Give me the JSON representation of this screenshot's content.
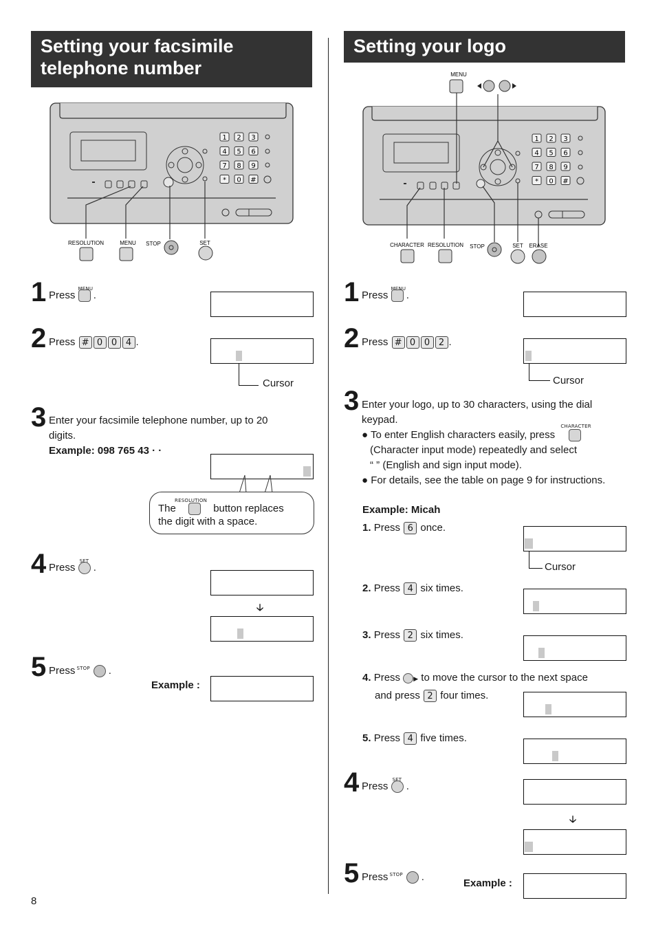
{
  "page_number": "8",
  "left": {
    "title_line1": "Setting your facsimile",
    "title_line2": "telephone number",
    "diagram_labels": {
      "resolution": "RESOLUTION",
      "menu": "MENU",
      "stop": "STOP",
      "set": "SET"
    },
    "keypad": [
      "1",
      "2",
      "3",
      "4",
      "5",
      "6",
      "7",
      "8",
      "9",
      "*",
      "0",
      "#"
    ],
    "steps": [
      {
        "num": "1",
        "text": "Press",
        "button": "MENU",
        "suffix": "."
      },
      {
        "num": "2",
        "text": "Press",
        "keys": [
          "#",
          "0",
          "0",
          "4"
        ],
        "suffix": ".",
        "cursor_label": "Cursor"
      },
      {
        "num": "3",
        "text_line1": "Enter your facsimile telephone number, up to 20",
        "text_line2": "digits.",
        "example": "Example: 098 765 43 · ·",
        "bubble_pre": "The",
        "bubble_button": "RESOLUTION",
        "bubble_post": "button replaces",
        "bubble_line2": "the digit with a space."
      },
      {
        "num": "4",
        "text": "Press",
        "button": "SET",
        "suffix": "."
      },
      {
        "num": "5",
        "text": "Press",
        "button": "STOP",
        "suffix": ".",
        "example_label": "Example :"
      }
    ]
  },
  "right": {
    "title": "Setting your logo",
    "diagram_labels": {
      "menu": "MENU",
      "character": "CHARACTER",
      "resolution": "RESOLUTION",
      "stop": "STOP",
      "set": "SET",
      "erase": "ERASE"
    },
    "keypad": [
      "1",
      "2",
      "3",
      "4",
      "5",
      "6",
      "7",
      "8",
      "9",
      "*",
      "0",
      "#"
    ],
    "steps": [
      {
        "num": "1",
        "text": "Press",
        "button": "MENU",
        "suffix": "."
      },
      {
        "num": "2",
        "text": "Press",
        "keys": [
          "#",
          "0",
          "0",
          "2"
        ],
        "suffix": ".",
        "cursor_label": "Cursor"
      },
      {
        "num": "3",
        "text_line1": "Enter your logo, up to 30 characters, using the dial",
        "text_line2": "keypad.",
        "bullet1_a": "To enter English characters easily, press",
        "bullet1_button": "CHARACTER",
        "bullet1_b": "(Character input mode) repeatedly and select",
        "bullet1_c": "“    ” (English and sign input mode).",
        "bullet2": "For details, see the table on page 9 for instructions.",
        "example_title": "Example: Micah",
        "substeps": [
          {
            "n": "1.",
            "pre": "Press",
            "key": "6",
            "post": "once.",
            "cursor_label": "Cursor"
          },
          {
            "n": "2.",
            "pre": "Press",
            "key": "4",
            "post": "six times."
          },
          {
            "n": "3.",
            "pre": "Press",
            "key": "2",
            "post": "six times."
          },
          {
            "n": "4.",
            "pre": "Press",
            "post": "to move the cursor to the next space",
            "line2_pre": "and press",
            "key": "2",
            "line2_post": "four times."
          },
          {
            "n": "5.",
            "pre": "Press",
            "key": "4",
            "post": "five times."
          }
        ]
      },
      {
        "num": "4",
        "text": "Press",
        "button": "SET",
        "suffix": "."
      },
      {
        "num": "5",
        "text": "Press",
        "button": "STOP",
        "suffix": ".",
        "example_label": "Example :"
      }
    ]
  }
}
